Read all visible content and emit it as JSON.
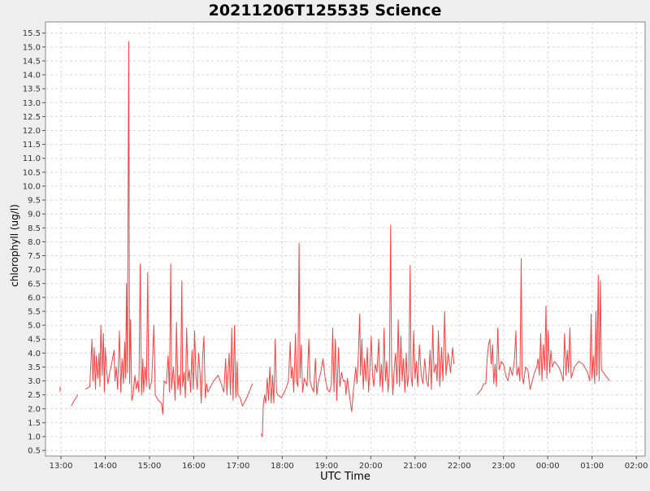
{
  "chart_data": {
    "type": "line",
    "title": "20211206T125535 Science",
    "xlabel": "UTC Time",
    "ylabel": "chlorophyll (ug/l)",
    "x_tick_labels": [
      "13:00",
      "14:00",
      "15:00",
      "16:00",
      "17:00",
      "18:00",
      "19:00",
      "20:00",
      "21:00",
      "22:00",
      "23:00",
      "00:00",
      "01:00",
      "02:00"
    ],
    "y_tick_labels": [
      "0.5",
      "1.0",
      "1.5",
      "2.0",
      "2.5",
      "3.0",
      "3.5",
      "4.0",
      "4.5",
      "5.0",
      "5.5",
      "6.0",
      "6.5",
      "7.0",
      "7.5",
      "8.0",
      "8.5",
      "9.0",
      "9.5",
      "10.0",
      "10.5",
      "11.0",
      "11.5",
      "12.0",
      "12.5",
      "13.0",
      "13.5",
      "14.0",
      "14.5",
      "15.0",
      "15.5"
    ],
    "xlim_hours": [
      12.65,
      26.2
    ],
    "ylim": [
      0.3,
      15.9
    ],
    "grid": true,
    "line_color": "#ff4040",
    "series": [
      {
        "points": [
          [
            12.98,
            2.8
          ],
          [
            12.98,
            2.6
          ],
          [
            13.23,
            2.1
          ],
          [
            13.3,
            2.3
          ],
          [
            13.38,
            2.5
          ],
          [
            13.55,
            2.7
          ],
          [
            13.65,
            2.8
          ],
          [
            13.7,
            4.5
          ],
          [
            13.72,
            3.0
          ],
          [
            13.75,
            4.2
          ],
          [
            13.78,
            2.7
          ],
          [
            13.8,
            3.9
          ],
          [
            13.83,
            3.1
          ],
          [
            13.86,
            4.0
          ],
          [
            13.88,
            2.8
          ],
          [
            13.9,
            5.0
          ],
          [
            13.93,
            3.2
          ],
          [
            13.96,
            4.7
          ],
          [
            13.98,
            2.6
          ],
          [
            14.0,
            4.2
          ],
          [
            14.03,
            3.4
          ],
          [
            14.06,
            2.9
          ],
          [
            14.1,
            3.3
          ],
          [
            14.14,
            3.6
          ],
          [
            14.2,
            4.1
          ],
          [
            14.22,
            3.0
          ],
          [
            14.25,
            3.5
          ],
          [
            14.28,
            2.7
          ],
          [
            14.32,
            4.8
          ],
          [
            14.35,
            2.6
          ],
          [
            14.38,
            3.8
          ],
          [
            14.41,
            2.9
          ],
          [
            14.44,
            4.4
          ],
          [
            14.46,
            3.1
          ],
          [
            14.48,
            6.5
          ],
          [
            14.5,
            3.3
          ],
          [
            14.53,
            15.2
          ],
          [
            14.55,
            2.9
          ],
          [
            14.57,
            5.2
          ],
          [
            14.6,
            2.3
          ],
          [
            14.63,
            2.5
          ],
          [
            14.67,
            3.2
          ],
          [
            14.7,
            2.7
          ],
          [
            14.73,
            3.0
          ],
          [
            14.76,
            2.6
          ],
          [
            14.79,
            7.2
          ],
          [
            14.82,
            2.5
          ],
          [
            14.85,
            3.8
          ],
          [
            14.87,
            2.6
          ],
          [
            14.9,
            3.5
          ],
          [
            14.93,
            2.8
          ],
          [
            14.96,
            6.9
          ],
          [
            14.98,
            3.1
          ],
          [
            15.0,
            2.7
          ],
          [
            15.05,
            3.0
          ],
          [
            15.1,
            5.0
          ],
          [
            15.13,
            2.5
          ],
          [
            15.2,
            2.3
          ],
          [
            15.27,
            2.2
          ],
          [
            15.3,
            1.8
          ],
          [
            15.33,
            3.0
          ],
          [
            15.38,
            2.9
          ],
          [
            15.42,
            3.9
          ],
          [
            15.45,
            2.6
          ],
          [
            15.48,
            7.2
          ],
          [
            15.5,
            2.7
          ],
          [
            15.54,
            3.5
          ],
          [
            15.58,
            2.3
          ],
          [
            15.61,
            5.1
          ],
          [
            15.64,
            2.7
          ],
          [
            15.67,
            3.2
          ],
          [
            15.7,
            2.5
          ],
          [
            15.73,
            6.6
          ],
          [
            15.75,
            2.8
          ],
          [
            15.78,
            3.3
          ],
          [
            15.81,
            2.4
          ],
          [
            15.84,
            4.9
          ],
          [
            15.87,
            3.0
          ],
          [
            15.9,
            3.4
          ],
          [
            15.93,
            2.6
          ],
          [
            15.96,
            4.1
          ],
          [
            15.99,
            2.7
          ],
          [
            16.02,
            4.8
          ],
          [
            16.05,
            3.2
          ],
          [
            16.08,
            2.7
          ],
          [
            16.11,
            4.0
          ],
          [
            16.14,
            3.3
          ],
          [
            16.17,
            2.2
          ],
          [
            16.2,
            3.9
          ],
          [
            16.23,
            4.6
          ],
          [
            16.26,
            2.4
          ],
          [
            16.29,
            2.9
          ],
          [
            16.32,
            2.6
          ],
          [
            16.38,
            2.8
          ],
          [
            16.45,
            3.0
          ],
          [
            16.55,
            3.2
          ],
          [
            16.62,
            2.9
          ],
          [
            16.68,
            2.6
          ],
          [
            16.72,
            3.8
          ],
          [
            16.75,
            2.5
          ],
          [
            16.8,
            4.0
          ],
          [
            16.83,
            2.5
          ],
          [
            16.86,
            4.9
          ],
          [
            16.89,
            2.3
          ],
          [
            16.92,
            5.0
          ],
          [
            16.95,
            2.4
          ],
          [
            16.98,
            3.7
          ],
          [
            17.0,
            2.5
          ],
          [
            17.05,
            2.4
          ],
          [
            17.1,
            2.1
          ],
          [
            17.2,
            2.4
          ],
          [
            17.3,
            2.8
          ],
          [
            17.33,
            2.9
          ],
          [
            17.52,
            1.1
          ],
          [
            17.55,
            1.0
          ],
          [
            17.57,
            2.1
          ],
          [
            17.6,
            2.5
          ],
          [
            17.63,
            2.2
          ],
          [
            17.66,
            3.1
          ],
          [
            17.69,
            2.3
          ],
          [
            17.72,
            3.5
          ],
          [
            17.75,
            2.2
          ],
          [
            17.78,
            3.2
          ],
          [
            17.81,
            2.2
          ],
          [
            17.84,
            4.5
          ],
          [
            17.87,
            2.6
          ],
          [
            17.9,
            2.5
          ],
          [
            17.98,
            2.4
          ],
          [
            18.05,
            2.6
          ],
          [
            18.1,
            2.8
          ],
          [
            18.14,
            3.0
          ],
          [
            18.18,
            4.4
          ],
          [
            18.2,
            3.1
          ],
          [
            18.23,
            3.5
          ],
          [
            18.26,
            2.6
          ],
          [
            18.3,
            4.7
          ],
          [
            18.32,
            3.0
          ],
          [
            18.35,
            2.8
          ],
          [
            18.38,
            7.95
          ],
          [
            18.4,
            3.1
          ],
          [
            18.43,
            4.3
          ],
          [
            18.46,
            2.6
          ],
          [
            18.5,
            3.1
          ],
          [
            18.56,
            2.8
          ],
          [
            18.6,
            4.5
          ],
          [
            18.63,
            3.0
          ],
          [
            18.66,
            2.8
          ],
          [
            18.71,
            2.6
          ],
          [
            18.75,
            3.8
          ],
          [
            18.78,
            2.5
          ],
          [
            18.82,
            3.0
          ],
          [
            18.87,
            3.3
          ],
          [
            18.92,
            3.8
          ],
          [
            18.97,
            3.1
          ],
          [
            19.02,
            2.7
          ],
          [
            19.07,
            2.6
          ],
          [
            19.11,
            2.9
          ],
          [
            19.14,
            4.9
          ],
          [
            19.17,
            2.6
          ],
          [
            19.2,
            4.5
          ],
          [
            19.23,
            2.3
          ],
          [
            19.27,
            4.2
          ],
          [
            19.3,
            2.8
          ],
          [
            19.34,
            3.3
          ],
          [
            19.38,
            3.0
          ],
          [
            19.42,
            3.0
          ],
          [
            19.44,
            2.5
          ],
          [
            19.47,
            3.1
          ],
          [
            19.55,
            2.1
          ],
          [
            19.57,
            1.9
          ],
          [
            19.6,
            2.5
          ],
          [
            19.63,
            3.0
          ],
          [
            19.66,
            3.5
          ],
          [
            19.69,
            2.9
          ],
          [
            19.72,
            4.0
          ],
          [
            19.75,
            5.4
          ],
          [
            19.77,
            3.2
          ],
          [
            19.8,
            4.5
          ],
          [
            19.83,
            2.7
          ],
          [
            19.86,
            3.8
          ],
          [
            19.89,
            3.0
          ],
          [
            19.92,
            4.2
          ],
          [
            19.95,
            2.6
          ],
          [
            19.98,
            3.4
          ],
          [
            20.01,
            4.6
          ],
          [
            20.04,
            3.2
          ],
          [
            20.07,
            2.8
          ],
          [
            20.1,
            3.6
          ],
          [
            20.14,
            3.3
          ],
          [
            20.18,
            4.5
          ],
          [
            20.21,
            2.8
          ],
          [
            20.24,
            3.6
          ],
          [
            20.27,
            2.6
          ],
          [
            20.3,
            4.9
          ],
          [
            20.33,
            3.0
          ],
          [
            20.36,
            3.7
          ],
          [
            20.39,
            2.6
          ],
          [
            20.42,
            3.3
          ],
          [
            20.45,
            8.6
          ],
          [
            20.47,
            3.6
          ],
          [
            20.5,
            2.5
          ],
          [
            20.53,
            3.4
          ],
          [
            20.56,
            4.0
          ],
          [
            20.59,
            2.9
          ],
          [
            20.62,
            5.2
          ],
          [
            20.65,
            2.8
          ],
          [
            20.68,
            4.6
          ],
          [
            20.71,
            3.0
          ],
          [
            20.74,
            3.8
          ],
          [
            20.77,
            2.6
          ],
          [
            20.8,
            4.0
          ],
          [
            20.83,
            2.8
          ],
          [
            20.86,
            3.3
          ],
          [
            20.89,
            7.15
          ],
          [
            20.91,
            3.2
          ],
          [
            20.94,
            2.8
          ],
          [
            20.97,
            4.8
          ],
          [
            21.0,
            3.1
          ],
          [
            21.03,
            3.7
          ],
          [
            21.06,
            2.8
          ],
          [
            21.1,
            4.3
          ],
          [
            21.14,
            3.2
          ],
          [
            21.18,
            2.9
          ],
          [
            21.22,
            3.8
          ],
          [
            21.26,
            3.0
          ],
          [
            21.3,
            2.8
          ],
          [
            21.34,
            4.1
          ],
          [
            21.37,
            2.7
          ],
          [
            21.4,
            5.0
          ],
          [
            21.43,
            3.3
          ],
          [
            21.47,
            3.6
          ],
          [
            21.5,
            3.0
          ],
          [
            21.53,
            4.8
          ],
          [
            21.56,
            2.8
          ],
          [
            21.6,
            4.2
          ],
          [
            21.63,
            3.0
          ],
          [
            21.67,
            5.5
          ],
          [
            21.7,
            3.2
          ],
          [
            21.75,
            4.0
          ],
          [
            21.8,
            3.3
          ],
          [
            21.85,
            4.2
          ],
          [
            21.88,
            3.6
          ],
          [
            22.4,
            2.5
          ],
          [
            22.45,
            2.6
          ],
          [
            22.5,
            2.7
          ],
          [
            22.55,
            2.9
          ],
          [
            22.6,
            2.9
          ],
          [
            22.63,
            3.8
          ],
          [
            22.66,
            4.3
          ],
          [
            22.69,
            4.5
          ],
          [
            22.72,
            3.6
          ],
          [
            22.75,
            4.3
          ],
          [
            22.78,
            2.9
          ],
          [
            22.81,
            3.6
          ],
          [
            22.84,
            2.8
          ],
          [
            22.87,
            4.9
          ],
          [
            22.9,
            3.4
          ],
          [
            22.95,
            3.7
          ],
          [
            23.0,
            3.6
          ],
          [
            23.05,
            3.2
          ],
          [
            23.1,
            3.0
          ],
          [
            23.15,
            3.5
          ],
          [
            23.2,
            3.2
          ],
          [
            23.25,
            3.8
          ],
          [
            23.28,
            4.8
          ],
          [
            23.3,
            3.2
          ],
          [
            23.34,
            3.5
          ],
          [
            23.37,
            3.0
          ],
          [
            23.4,
            7.4
          ],
          [
            23.42,
            3.2
          ],
          [
            23.45,
            2.9
          ],
          [
            23.5,
            3.5
          ],
          [
            23.55,
            3.4
          ],
          [
            23.6,
            2.7
          ],
          [
            23.65,
            3.0
          ],
          [
            23.7,
            3.3
          ],
          [
            23.75,
            3.5
          ],
          [
            23.78,
            3.8
          ],
          [
            23.81,
            3.2
          ],
          [
            23.84,
            4.7
          ],
          [
            23.87,
            3.0
          ],
          [
            23.9,
            4.3
          ],
          [
            23.93,
            3.4
          ],
          [
            23.96,
            5.7
          ],
          [
            23.98,
            3.1
          ],
          [
            24.01,
            4.8
          ],
          [
            24.04,
            3.3
          ],
          [
            24.07,
            4.1
          ],
          [
            24.1,
            3.5
          ],
          [
            24.15,
            3.7
          ],
          [
            24.2,
            3.6
          ],
          [
            24.25,
            3.5
          ],
          [
            24.3,
            3.3
          ],
          [
            24.35,
            3.0
          ],
          [
            24.38,
            4.7
          ],
          [
            24.41,
            3.2
          ],
          [
            24.44,
            4.1
          ],
          [
            24.47,
            3.3
          ],
          [
            24.5,
            4.9
          ],
          [
            24.53,
            3.1
          ],
          [
            24.6,
            3.5
          ],
          [
            24.7,
            3.7
          ],
          [
            24.8,
            3.6
          ],
          [
            24.9,
            3.3
          ],
          [
            24.95,
            3.0
          ],
          [
            24.98,
            5.4
          ],
          [
            25.0,
            3.1
          ],
          [
            25.03,
            3.9
          ],
          [
            25.06,
            2.9
          ],
          [
            25.09,
            5.5
          ],
          [
            25.11,
            3.2
          ],
          [
            25.14,
            6.8
          ],
          [
            25.16,
            3.0
          ],
          [
            25.19,
            6.6
          ],
          [
            25.21,
            3.4
          ],
          [
            25.3,
            3.2
          ],
          [
            25.4,
            3.0
          ]
        ]
      }
    ]
  }
}
